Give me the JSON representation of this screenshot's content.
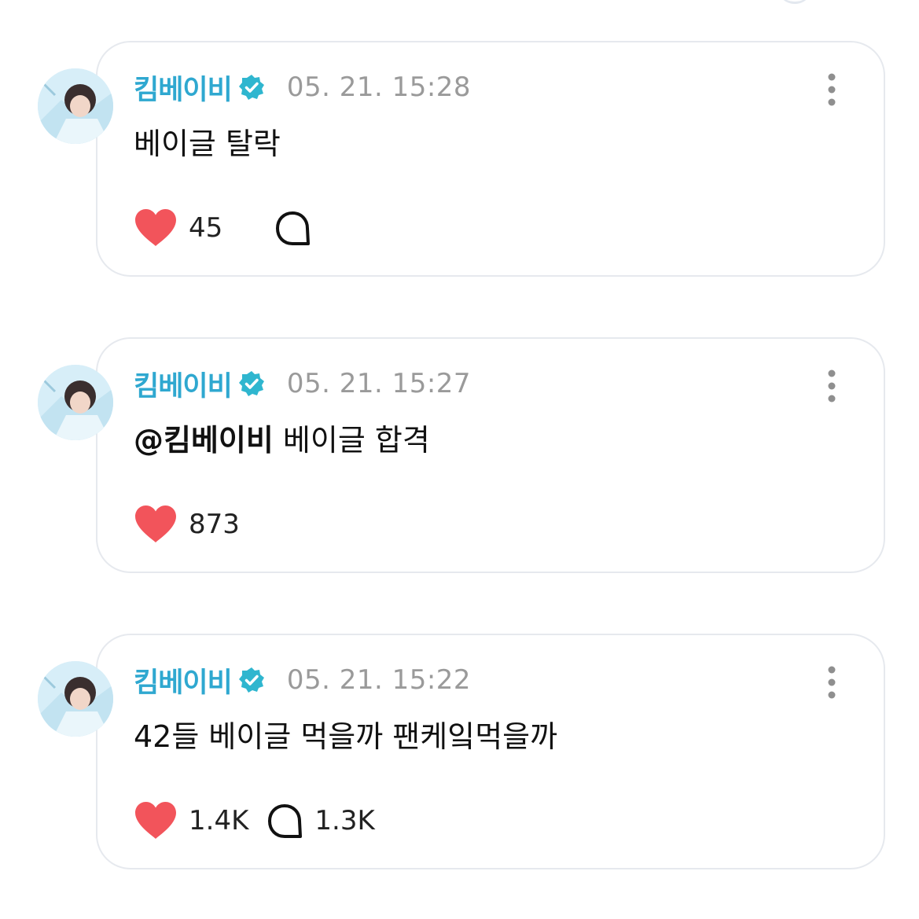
{
  "colors": {
    "username": "#2fa8d0",
    "verified_badge": "#2fb6cf",
    "timestamp": "#9a9a9a",
    "like_heart": "#f2545b",
    "card_border": "#e6e9ee"
  },
  "icons": {
    "verified": "verified-badge-icon",
    "more": "more-vertical-icon",
    "like": "heart-icon",
    "comment": "comment-bubble-icon"
  },
  "posts": [
    {
      "author": "킴베이비",
      "timestamp": "05. 21. 15:28",
      "mention": "",
      "text": "베이글 탈락",
      "likes": "45",
      "comments": ""
    },
    {
      "author": "킴베이비",
      "timestamp": "05. 21. 15:27",
      "mention": "@킴베이비",
      "text": " 베이글 합격",
      "likes": "873",
      "comments": ""
    },
    {
      "author": "킴베이비",
      "timestamp": "05. 21. 15:22",
      "mention": "",
      "text": "42들 베이글 먹을까 팬케잌먹을까",
      "likes": "1.4K",
      "comments": "1.3K"
    }
  ]
}
